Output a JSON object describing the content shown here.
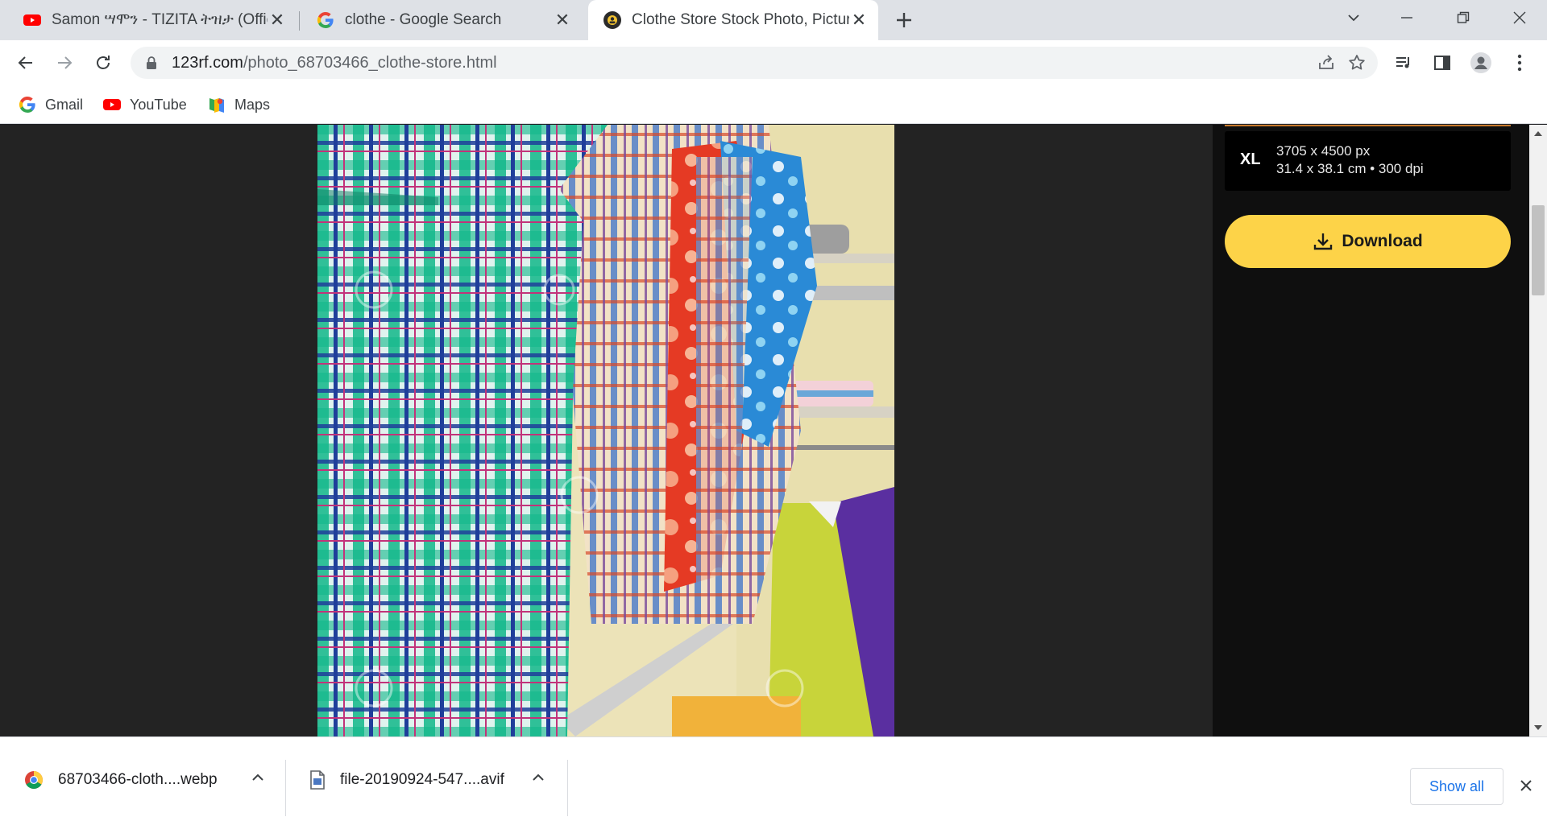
{
  "tabs": [
    {
      "title": "Samon ሣሞን - TIZITA ትዝታ (Official",
      "favicon": "youtube-icon"
    },
    {
      "title": "clothe - Google Search",
      "favicon": "google-icon"
    },
    {
      "title": "Clothe Store Stock Photo, Picture",
      "favicon": "123rf-icon",
      "active": true
    }
  ],
  "toolbar": {
    "url_host": "123rf.com",
    "url_path": "/photo_68703466_clothe-store.html"
  },
  "bookmarks": [
    {
      "label": "Gmail",
      "icon": "google-icon"
    },
    {
      "label": "YouTube",
      "icon": "youtube-icon"
    },
    {
      "label": "Maps",
      "icon": "maps-icon"
    }
  ],
  "panel": {
    "size_label": "XL",
    "size_px": "3705 x 4500 px",
    "size_cm": "31.4 x 38.1 cm • 300 dpi",
    "download_label": "Download"
  },
  "downloads": [
    {
      "name": "68703466-cloth....webp",
      "icon": "chrome-icon"
    },
    {
      "name": "file-20190924-547....avif",
      "icon": "file-icon"
    }
  ],
  "downloads_bar": {
    "show_all": "Show all"
  },
  "colors": {
    "accent_yellow": "#fdd348",
    "page_bg": "#232323",
    "link_blue": "#1a73e8"
  }
}
